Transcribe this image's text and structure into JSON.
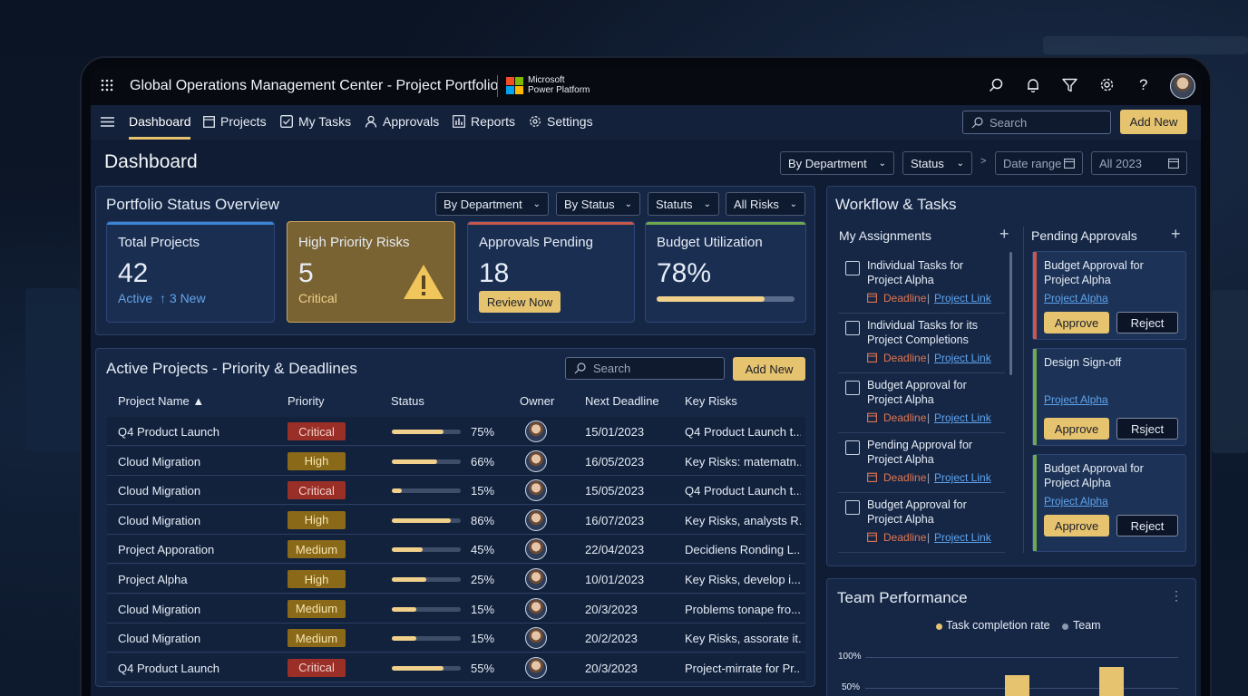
{
  "app": {
    "title": "Global Operations Management Center - Project Portfolio",
    "brand_line1": "Microsoft",
    "brand_line2": "Power Platform"
  },
  "nav": {
    "items": [
      {
        "label": "Dashboard",
        "icon": "menu-icon"
      },
      {
        "label": "Projects",
        "icon": "projects-icon"
      },
      {
        "label": "My Tasks",
        "icon": "checkbox-icon"
      },
      {
        "label": "Approvals",
        "icon": "person-icon"
      },
      {
        "label": "Reports",
        "icon": "chart-icon"
      },
      {
        "label": "Settings",
        "icon": "gear-icon"
      }
    ],
    "search_placeholder": "Search",
    "add_new": "Add New"
  },
  "page": {
    "title": "Dashboard",
    "filters": {
      "department": "By Department",
      "status": "Status",
      "date_range": "Date range",
      "year": "All 2023"
    }
  },
  "portfolio": {
    "title": "Portfolio Status Overview",
    "filters": [
      "By Department",
      "By Status",
      "Statuts",
      "All Risks"
    ],
    "kpis": {
      "total": {
        "title": "Total Projects",
        "value": "42",
        "sub_a": "Active",
        "sub_b": "↑ 3 New"
      },
      "risks": {
        "title": "High Priority Risks",
        "value": "5",
        "sub": "Critical"
      },
      "approvals": {
        "title": "Approvals Pending",
        "value": "18",
        "button": "Review Now"
      },
      "budget": {
        "title": "Budget Utilization",
        "value": "78%",
        "fill": 0.78
      }
    },
    "colors": {
      "blue": "#3b86d6",
      "gold": "#e6c36f",
      "red": "#c8584b",
      "green": "#6fa84f"
    }
  },
  "projects": {
    "title": "Active Projects - Priority & Deadlines",
    "search_placeholder": "Search",
    "add_new": "Add New",
    "headers": {
      "name": "Project Name ▲",
      "priority": "Priority",
      "status": "Status",
      "owner": "Owner",
      "deadline": "Next Deadline",
      "risks": "Key Risks"
    },
    "rows": [
      {
        "name": "Q4 Product Launch",
        "priority": "Critical",
        "pct": "75%",
        "progress": 0.75,
        "deadline": "15/01/2023",
        "risk": "Q4 Product Launch t..."
      },
      {
        "name": "Cloud Migration",
        "priority": "High",
        "pct": "66%",
        "progress": 0.66,
        "deadline": "16/05/2023",
        "risk": "Key Risks: matematn..."
      },
      {
        "name": "Cloud Migration",
        "priority": "Critical",
        "pct": "15%",
        "progress": 0.15,
        "deadline": "15/05/2023",
        "risk": "Q4 Product Launch t..."
      },
      {
        "name": "Cloud Migration",
        "priority": "High",
        "pct": "86%",
        "progress": 0.86,
        "deadline": "16/07/2023",
        "risk": "Key Risks, analysts R..."
      },
      {
        "name": "Project Apporation",
        "priority": "Medium",
        "pct": "45%",
        "progress": 0.45,
        "deadline": "22/04/2023",
        "risk": "Decidiens Ronding L..."
      },
      {
        "name": "Project Alpha",
        "priority": "High",
        "pct": "25%",
        "progress": 0.5,
        "deadline": "10/01/2023",
        "risk": "Key Risks, develop i..."
      },
      {
        "name": "Cloud Migration",
        "priority": "Medium",
        "pct": "15%",
        "progress": 0.35,
        "deadline": "20/3/2023",
        "risk": "Problems tonape fro..."
      },
      {
        "name": "Cloud Migration",
        "priority": "Medium",
        "pct": "15%",
        "progress": 0.35,
        "deadline": "20/2/2023",
        "risk": "Key Risks, assorate it..."
      },
      {
        "name": "Q4 Product Launch",
        "priority": "Critical",
        "pct": "55%",
        "progress": 0.75,
        "deadline": "20/3/2023",
        "risk": "Project-mirrate for Pr..."
      }
    ]
  },
  "workflow": {
    "title": "Workflow & Tasks",
    "assignments_title": "My Assignments",
    "approvals_title": "Pending Approvals",
    "assignments": [
      {
        "line1": "Individual Tasks for",
        "line2": "Project Alpha",
        "deadline": "Deadline",
        "link": "Project Link"
      },
      {
        "line1": "Individual Tasks for its",
        "line2": "Project Completions",
        "deadline": "Deadline",
        "link": "Project Link"
      },
      {
        "line1": "Budget Approval for",
        "line2": "Project Alpha",
        "deadline": "Deadline",
        "link": "Project Link"
      },
      {
        "line1": "Pending Approval for",
        "line2": "Project Alpha",
        "deadline": "Deadline",
        "link": "Project Link"
      },
      {
        "line1": "Budget Approval for",
        "line2": "Project Alpha",
        "deadline": "Deadline",
        "link": "Project Link"
      }
    ],
    "approvals": [
      {
        "line1": "Budget Approval for",
        "line2": "Project Alpha",
        "link": "Project Alpha",
        "approve": "Approve",
        "reject": "Reject",
        "color": "#c8584b"
      },
      {
        "line1": "Design Sign-off",
        "line2": "",
        "link": "Project Alpha",
        "approve": "Approve",
        "reject": "Rsject",
        "color": "#6fa84f"
      },
      {
        "line1": "Budget Approval for",
        "line2": "Project Alpha",
        "link": "Project Alpha",
        "approve": "Approve",
        "reject": "Reject",
        "color": "#6fa84f"
      }
    ]
  },
  "team": {
    "title": "Team Performance",
    "legend_a": "Task completion rate",
    "legend_b": "Team",
    "y_top": "100%",
    "y_second": "50%"
  },
  "chart_data": {
    "type": "bar",
    "title": "Team Performance",
    "series": [
      {
        "name": "Task completion rate",
        "values": [
          null,
          null
        ]
      }
    ],
    "legend": [
      "Task completion rate",
      "Team"
    ],
    "ylim": [
      0,
      100
    ],
    "ytick_labels": [
      "100%",
      "50%"
    ]
  }
}
